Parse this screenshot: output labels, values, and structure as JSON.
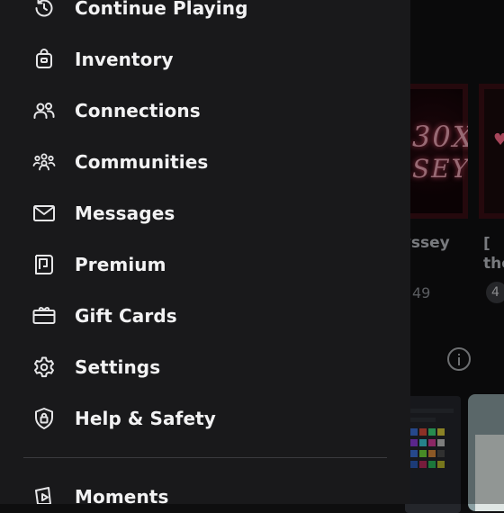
{
  "background": {
    "card1_title": "lyssey",
    "card1_count": "49",
    "card2_title_line1": "[",
    "card2_title_line2": "the",
    "card2_badge": "4",
    "card1_art_line1": "30X",
    "card1_art_line2": "SEY"
  },
  "drawer": {
    "items": [
      {
        "label": "Continue Playing",
        "icon": "history-icon"
      },
      {
        "label": "Inventory",
        "icon": "backpack-icon"
      },
      {
        "label": "Connections",
        "icon": "people-icon"
      },
      {
        "label": "Communities",
        "icon": "group-icon"
      },
      {
        "label": "Messages",
        "icon": "envelope-icon"
      },
      {
        "label": "Premium",
        "icon": "premium-icon"
      },
      {
        "label": "Gift Cards",
        "icon": "gift-card-icon"
      },
      {
        "label": "Settings",
        "icon": "gear-icon"
      },
      {
        "label": "Help & Safety",
        "icon": "shield-lock-icon"
      },
      {
        "label": "Moments",
        "icon": "play-doc-icon"
      }
    ]
  },
  "colors": {
    "drawer_bg": "#19191b",
    "text": "#f2f2f3",
    "icon": "#e6e6e8",
    "divider": "#3a3a3e"
  }
}
